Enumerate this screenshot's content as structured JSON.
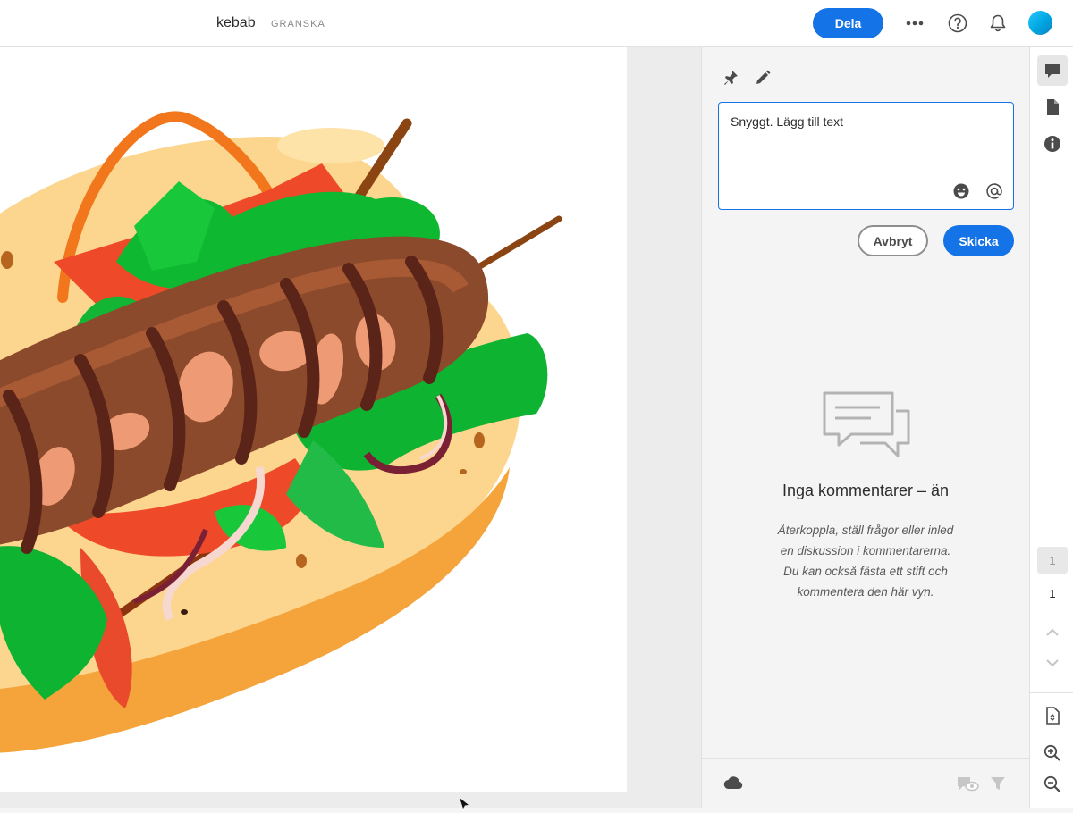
{
  "header": {
    "doc_title": "kebab",
    "mode_label": "GRANSKA",
    "share_label": "Dela",
    "icons": [
      "more-icon",
      "help-icon",
      "bell-icon"
    ],
    "accent": "#1473e6"
  },
  "canvas": {
    "artwork": "kebab illustration"
  },
  "comment_panel": {
    "tools": [
      "pin-icon",
      "pencil-icon"
    ],
    "input_value": "Snyggt. Lägg till text",
    "cancel_label": "Avbryt",
    "send_label": "Skicka",
    "empty_title": "Inga kommentarer – än",
    "empty_description": "Återkoppla, ställ frågor eller inled en diskussion i kommentarerna. Du kan också fästa ett stift och kommentera den här vyn."
  },
  "right_rail": {
    "current_page": "1",
    "total_pages": "1",
    "icons": [
      "comment-icon",
      "document-icon",
      "info-icon",
      "chevron-up-icon",
      "chevron-down-icon",
      "fit-page-icon",
      "zoom-in-icon",
      "zoom-out-icon"
    ]
  }
}
